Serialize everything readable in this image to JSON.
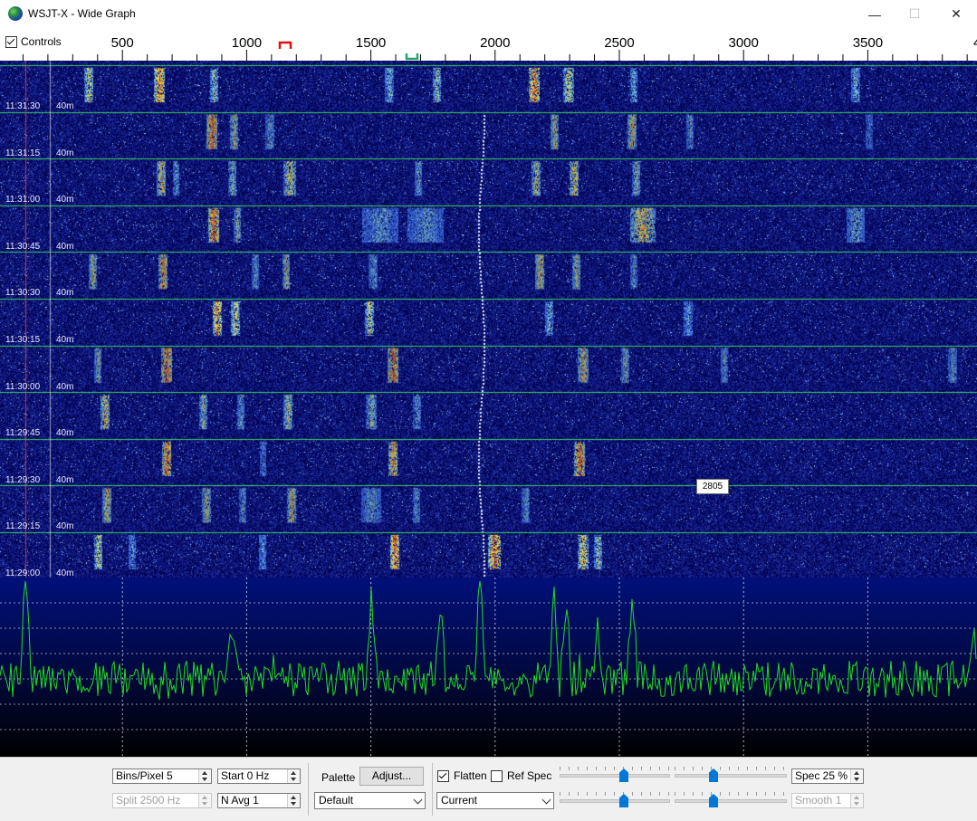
{
  "window": {
    "title": "WSJT-X - Wide Graph",
    "min": "—",
    "max": "☐",
    "close": "✕"
  },
  "controls_label": "Controls",
  "freq_scale": {
    "ticks": [
      "500",
      "1000",
      "1500",
      "2000",
      "2500",
      "3000",
      "3500",
      "4"
    ],
    "rx_marker_color": "#e01010",
    "tx_marker_color": "#2aa070"
  },
  "waterfall": {
    "time_labels": [
      "11:31:30",
      "11:31:15",
      "11:31:00",
      "11:30:45",
      "11:30:30",
      "11:30:15",
      "11:30:00",
      "11:29:45",
      "11:29:30",
      "11:29:15",
      "11:29:00"
    ],
    "band_labels": [
      "40m",
      "40m",
      "40m",
      "40m",
      "40m",
      "40m",
      "40m",
      "40m",
      "40m",
      "40m",
      "40m"
    ],
    "tooltip": "2805",
    "grid_color": "#3ccf5a"
  },
  "spectrum": {
    "trace_color": "#22dd22",
    "background": "#00107a"
  },
  "bottom": {
    "bins_per_pixel": "Bins/Pixel  5",
    "start": "Start 0 Hz",
    "split": "Split  2500  Hz",
    "n_avg": "N Avg  1",
    "palette_label": "Palette",
    "adjust_button": "Adjust...",
    "palette_value": "Default",
    "flatten_label": "Flatten",
    "ref_spec_label": "Ref Spec",
    "spectrum_mode": "Current",
    "spec_pct": "Spec 25 %",
    "smooth": "Smooth  1",
    "flatten_checked": true,
    "ref_spec_checked": false
  }
}
